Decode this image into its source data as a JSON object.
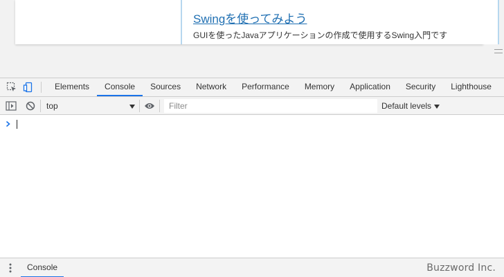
{
  "page": {
    "article_title": "Swingを使ってみよう",
    "article_description": "GUIを使ったJavaアプリケーションの作成で使用するSwing入門です"
  },
  "devtools": {
    "tabs": [
      {
        "label": "Elements",
        "active": false
      },
      {
        "label": "Console",
        "active": true
      },
      {
        "label": "Sources",
        "active": false
      },
      {
        "label": "Network",
        "active": false
      },
      {
        "label": "Performance",
        "active": false
      },
      {
        "label": "Memory",
        "active": false
      },
      {
        "label": "Application",
        "active": false
      },
      {
        "label": "Security",
        "active": false
      },
      {
        "label": "Lighthouse",
        "active": false
      }
    ],
    "toolbar_icons": [
      "inspect-element-icon",
      "device-toolbar-icon"
    ],
    "console_toolbar": {
      "context": "top",
      "filter_placeholder": "Filter",
      "levels": "Default levels"
    },
    "drawer": {
      "tab_label": "Console"
    },
    "accent_color": "#1a73e8"
  },
  "watermark": "Buzzword Inc."
}
